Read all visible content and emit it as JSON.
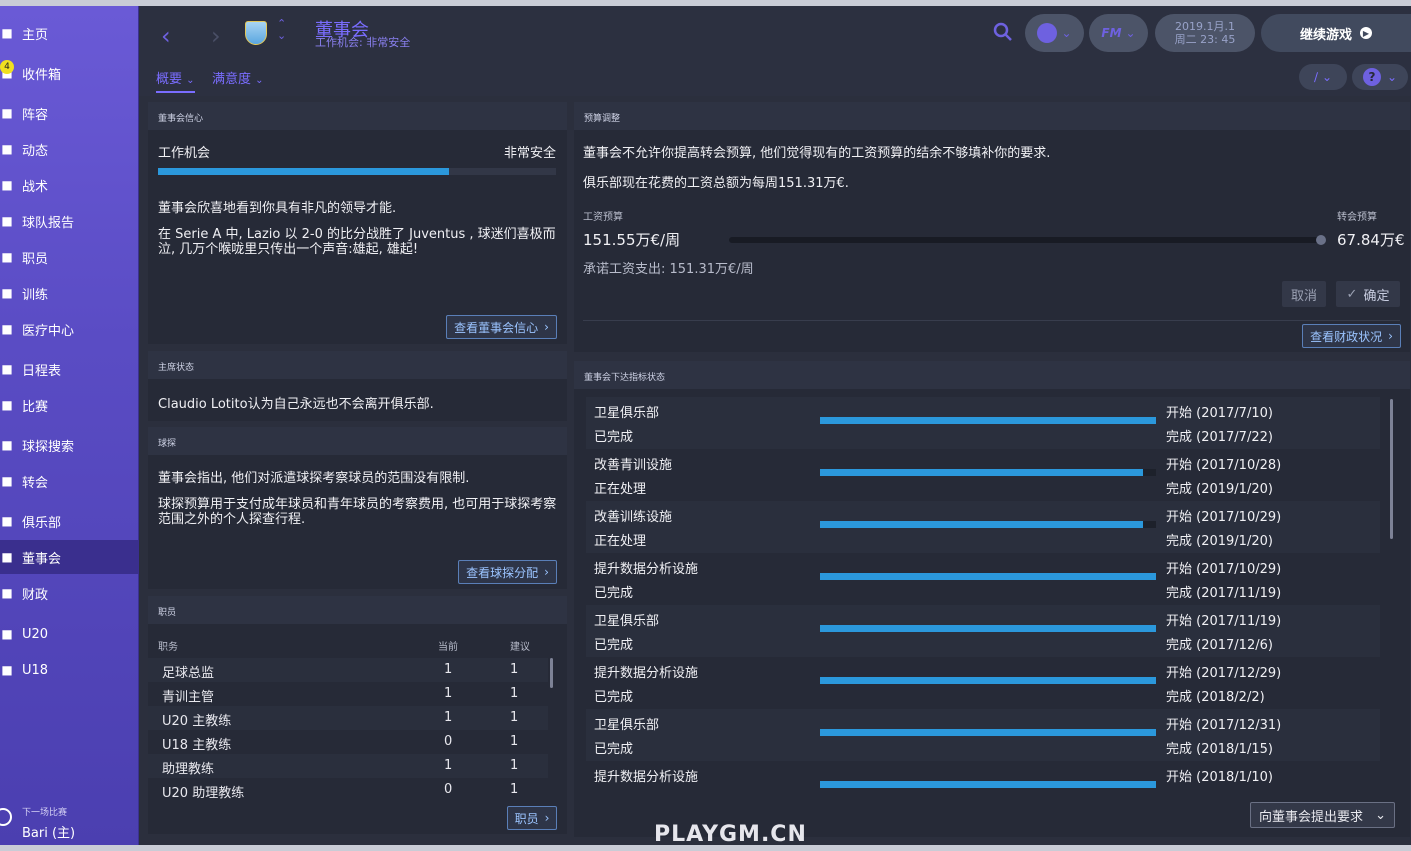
{
  "sidebar": {
    "items": [
      {
        "label": "主页",
        "icon": "home-icon"
      },
      {
        "label": "收件箱",
        "icon": "inbox-icon",
        "badge": "4"
      },
      {
        "label": "阵容",
        "icon": "squad-icon"
      },
      {
        "label": "动态",
        "icon": "dynamics-icon"
      },
      {
        "label": "战术",
        "icon": "tactics-icon"
      },
      {
        "label": "球队报告",
        "icon": "report-icon"
      },
      {
        "label": "职员",
        "icon": "staff-icon"
      },
      {
        "label": "训练",
        "icon": "training-icon"
      },
      {
        "label": "医疗中心",
        "icon": "medical-icon"
      },
      {
        "label": "日程表",
        "icon": "calendar-icon"
      },
      {
        "label": "比赛",
        "icon": "trophy-icon"
      },
      {
        "label": "球探搜索",
        "icon": "scouting-icon"
      },
      {
        "label": "转会",
        "icon": "transfer-icon"
      },
      {
        "label": "俱乐部",
        "icon": "club-icon"
      },
      {
        "label": "董事会",
        "icon": "board-icon"
      },
      {
        "label": "财政",
        "icon": "finance-icon"
      },
      {
        "label": "U20",
        "icon": "u20-icon"
      },
      {
        "label": "U18",
        "icon": "u18-icon"
      }
    ],
    "next_match": {
      "label": "下一场比赛",
      "value": "Bari (主)"
    }
  },
  "header": {
    "title": "董事会",
    "subtitle": "工作机会: 非常安全",
    "date_line1": "2019.1月.1",
    "date_line2": "周二 23: 45",
    "fm_label": "FM",
    "continue_label": "继续游戏",
    "tabs": [
      "概要",
      "满意度"
    ]
  },
  "confidence": {
    "head": "董事会信心",
    "job_label": "工作机会",
    "job_value": "非常安全",
    "job_level": 0.73,
    "text1": "董事会欣喜地看到你具有非凡的领导才能.",
    "text2": "在 Serie A 中, Lazio 以 2-0 的比分战胜了 Juventus , 球迷们喜极而泣, 几万个喉咙里只传出一个声音:雄起, 雄起!",
    "button": "查看董事会信心"
  },
  "chairman": {
    "head": "主席状态",
    "text": "Claudio Lotito认为自己永远也不会离开俱乐部."
  },
  "scouting": {
    "head": "球探",
    "text1": "董事会指出, 他们对派遣球探考察球员的范围没有限制.",
    "text2": "球探预算用于支付成年球员和青年球员的考察费用, 也可用于球探考察范围之外的个人探查行程.",
    "button": "查看球探分配"
  },
  "staff": {
    "head": "职员",
    "col_role": "职务",
    "col_current": "当前",
    "col_suggested": "建议",
    "rows": [
      {
        "role": "足球总监",
        "current": "1",
        "suggested": "1"
      },
      {
        "role": "青训主管",
        "current": "1",
        "suggested": "1"
      },
      {
        "role": "U20 主教练",
        "current": "1",
        "suggested": "1"
      },
      {
        "role": "U18 主教练",
        "current": "0",
        "suggested": "1"
      },
      {
        "role": "助理教练",
        "current": "1",
        "suggested": "1"
      },
      {
        "role": "U20 助理教练",
        "current": "0",
        "suggested": "1"
      }
    ],
    "button": "职员"
  },
  "budget": {
    "head": "预算调整",
    "text1": "董事会不允许你提高转会预算, 他们觉得现有的工资预算的结余不够填补你的要求.",
    "text2": "俱乐部现在花费的工资总额为每周151.31万€.",
    "wage_label": "工资预算",
    "wage_value": "151.55万€/周",
    "transfer_label": "转会预算",
    "transfer_value": "67.84万€",
    "committed": "承诺工资支出: 151.31万€/周",
    "cancel": "取消",
    "confirm": "确定",
    "finance_button": "查看财政状况"
  },
  "objectives": {
    "head": "董事会下达指标状态",
    "rows": [
      {
        "title": "卫星俱乐部",
        "status": "已完成",
        "start": "开始 (2017/7/10)",
        "end": "完成 (2017/7/22)",
        "progress": 1.0
      },
      {
        "title": "改善青训设施",
        "status": "正在处理",
        "start": "开始 (2017/10/28)",
        "end": "完成 (2019/1/20)",
        "progress": 0.96
      },
      {
        "title": "改善训练设施",
        "status": "正在处理",
        "start": "开始 (2017/10/29)",
        "end": "完成 (2019/1/20)",
        "progress": 0.96
      },
      {
        "title": "提升数据分析设施",
        "status": "已完成",
        "start": "开始 (2017/10/29)",
        "end": "完成 (2017/11/19)",
        "progress": 1.0
      },
      {
        "title": "卫星俱乐部",
        "status": "已完成",
        "start": "开始 (2017/11/19)",
        "end": "完成 (2017/12/6)",
        "progress": 1.0
      },
      {
        "title": "提升数据分析设施",
        "status": "已完成",
        "start": "开始 (2017/12/29)",
        "end": "完成 (2018/2/2)",
        "progress": 1.0
      },
      {
        "title": "卫星俱乐部",
        "status": "已完成",
        "start": "开始 (2017/12/31)",
        "end": "完成 (2018/1/15)",
        "progress": 1.0
      },
      {
        "title": "提升数据分析设施",
        "status": "",
        "start": "开始 (2018/1/10)",
        "end": "",
        "progress": 1.0
      }
    ],
    "request_button": "向董事会提出要求"
  },
  "watermark": "PLAYGM.CN"
}
